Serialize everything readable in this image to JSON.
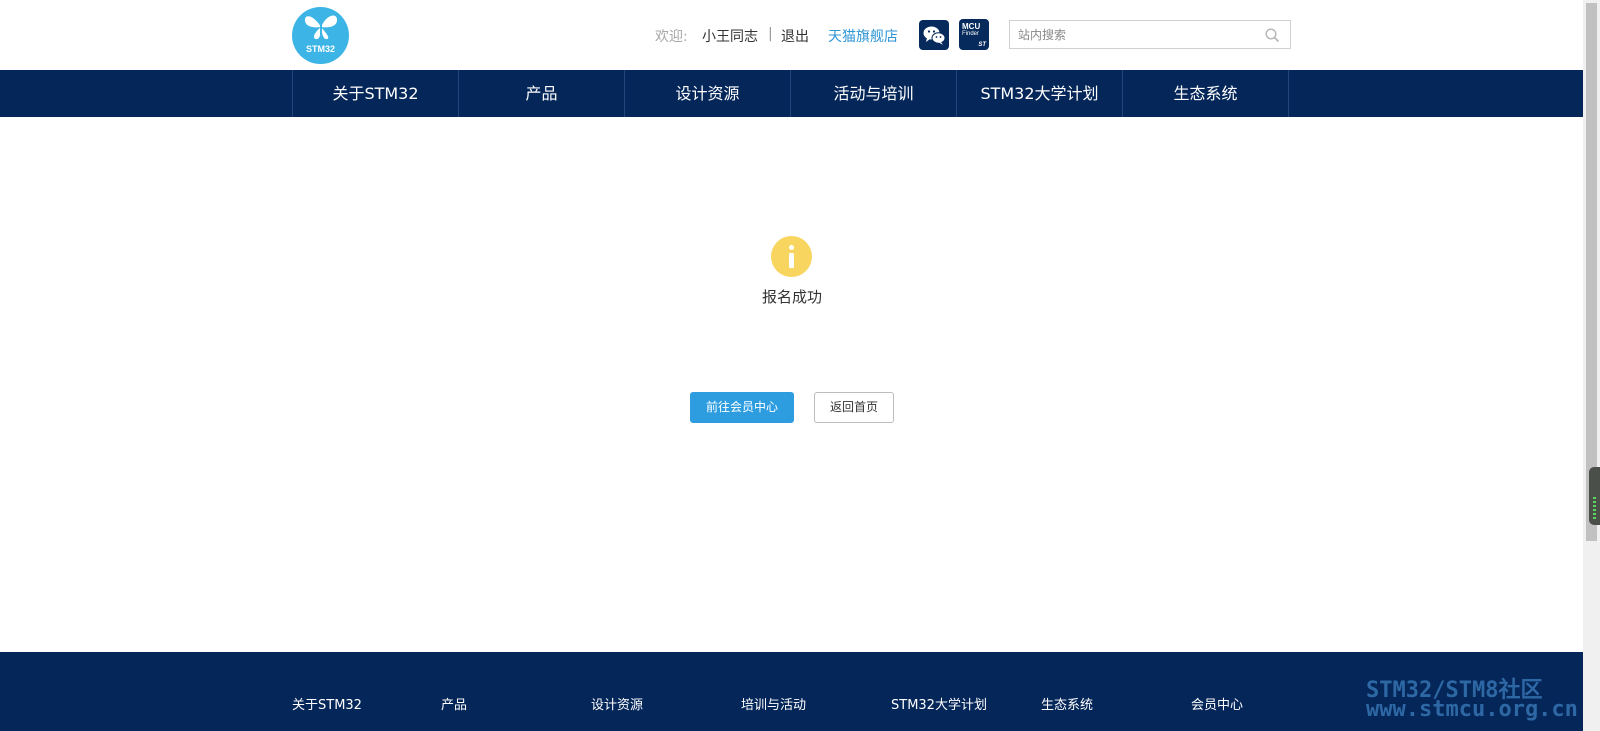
{
  "header": {
    "logo_text": "STM32",
    "welcome_label": "欢迎:",
    "username": "小王同志",
    "separator": "|",
    "logout": "退出",
    "tmall_link": "天猫旗舰店",
    "wechat_icon": "wechat-icon",
    "mcu_finder": {
      "line1": "MCU",
      "line2": "Finder",
      "brand": "ST"
    },
    "search": {
      "placeholder": "站内搜索",
      "icon": "search-icon"
    }
  },
  "nav": {
    "items": [
      {
        "label": "关于STM32"
      },
      {
        "label": "产品"
      },
      {
        "label": "设计资源"
      },
      {
        "label": "活动与培训"
      },
      {
        "label": "STM32大学计划"
      },
      {
        "label": "生态系统"
      }
    ]
  },
  "main": {
    "icon": "info-icon",
    "message": "报名成功",
    "primary_button": "前往会员中心",
    "secondary_button": "返回首页"
  },
  "footer": {
    "items": [
      {
        "label": "关于STM32"
      },
      {
        "label": "产品"
      },
      {
        "label": "设计资源"
      },
      {
        "label": "培训与活动"
      },
      {
        "label": "STM32大学计划"
      },
      {
        "label": "生态系统"
      },
      {
        "label": "会员中心"
      }
    ]
  },
  "watermark": {
    "line1": "STM32/STM8社区",
    "line2": "www.stmcu.org.cn"
  },
  "colors": {
    "nav_bg": "#052659",
    "logo_blue": "#3cb4e5",
    "link_blue": "#2f96d6",
    "primary_button": "#2d9de0",
    "info_yellow": "#f8d55f"
  }
}
